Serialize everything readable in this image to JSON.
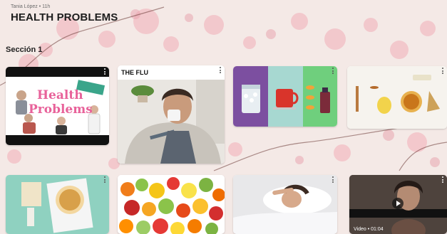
{
  "header": {
    "author": "Tania López • 11h",
    "title": "HEALTH PROBLEMS"
  },
  "section": {
    "title": "Sección 1"
  },
  "cards": [
    {
      "type": "image",
      "title": "",
      "badge": "",
      "overlay_text": [
        "Health",
        "Problems"
      ]
    },
    {
      "type": "image",
      "title": "THE FLU"
    },
    {
      "type": "image",
      "title": ""
    },
    {
      "type": "image",
      "title": ""
    },
    {
      "type": "image",
      "title": ""
    },
    {
      "type": "image",
      "title": ""
    },
    {
      "type": "image",
      "title": ""
    },
    {
      "type": "video",
      "title": "",
      "video_label": "Video • 01:04"
    }
  ],
  "colors": {
    "background": "#f4e9e6",
    "blossom": "#f2b7bf",
    "branch": "#6b3a36",
    "accent_pink": "#e8629a"
  },
  "icons": [
    "more-vertical-icon",
    "play-icon"
  ]
}
